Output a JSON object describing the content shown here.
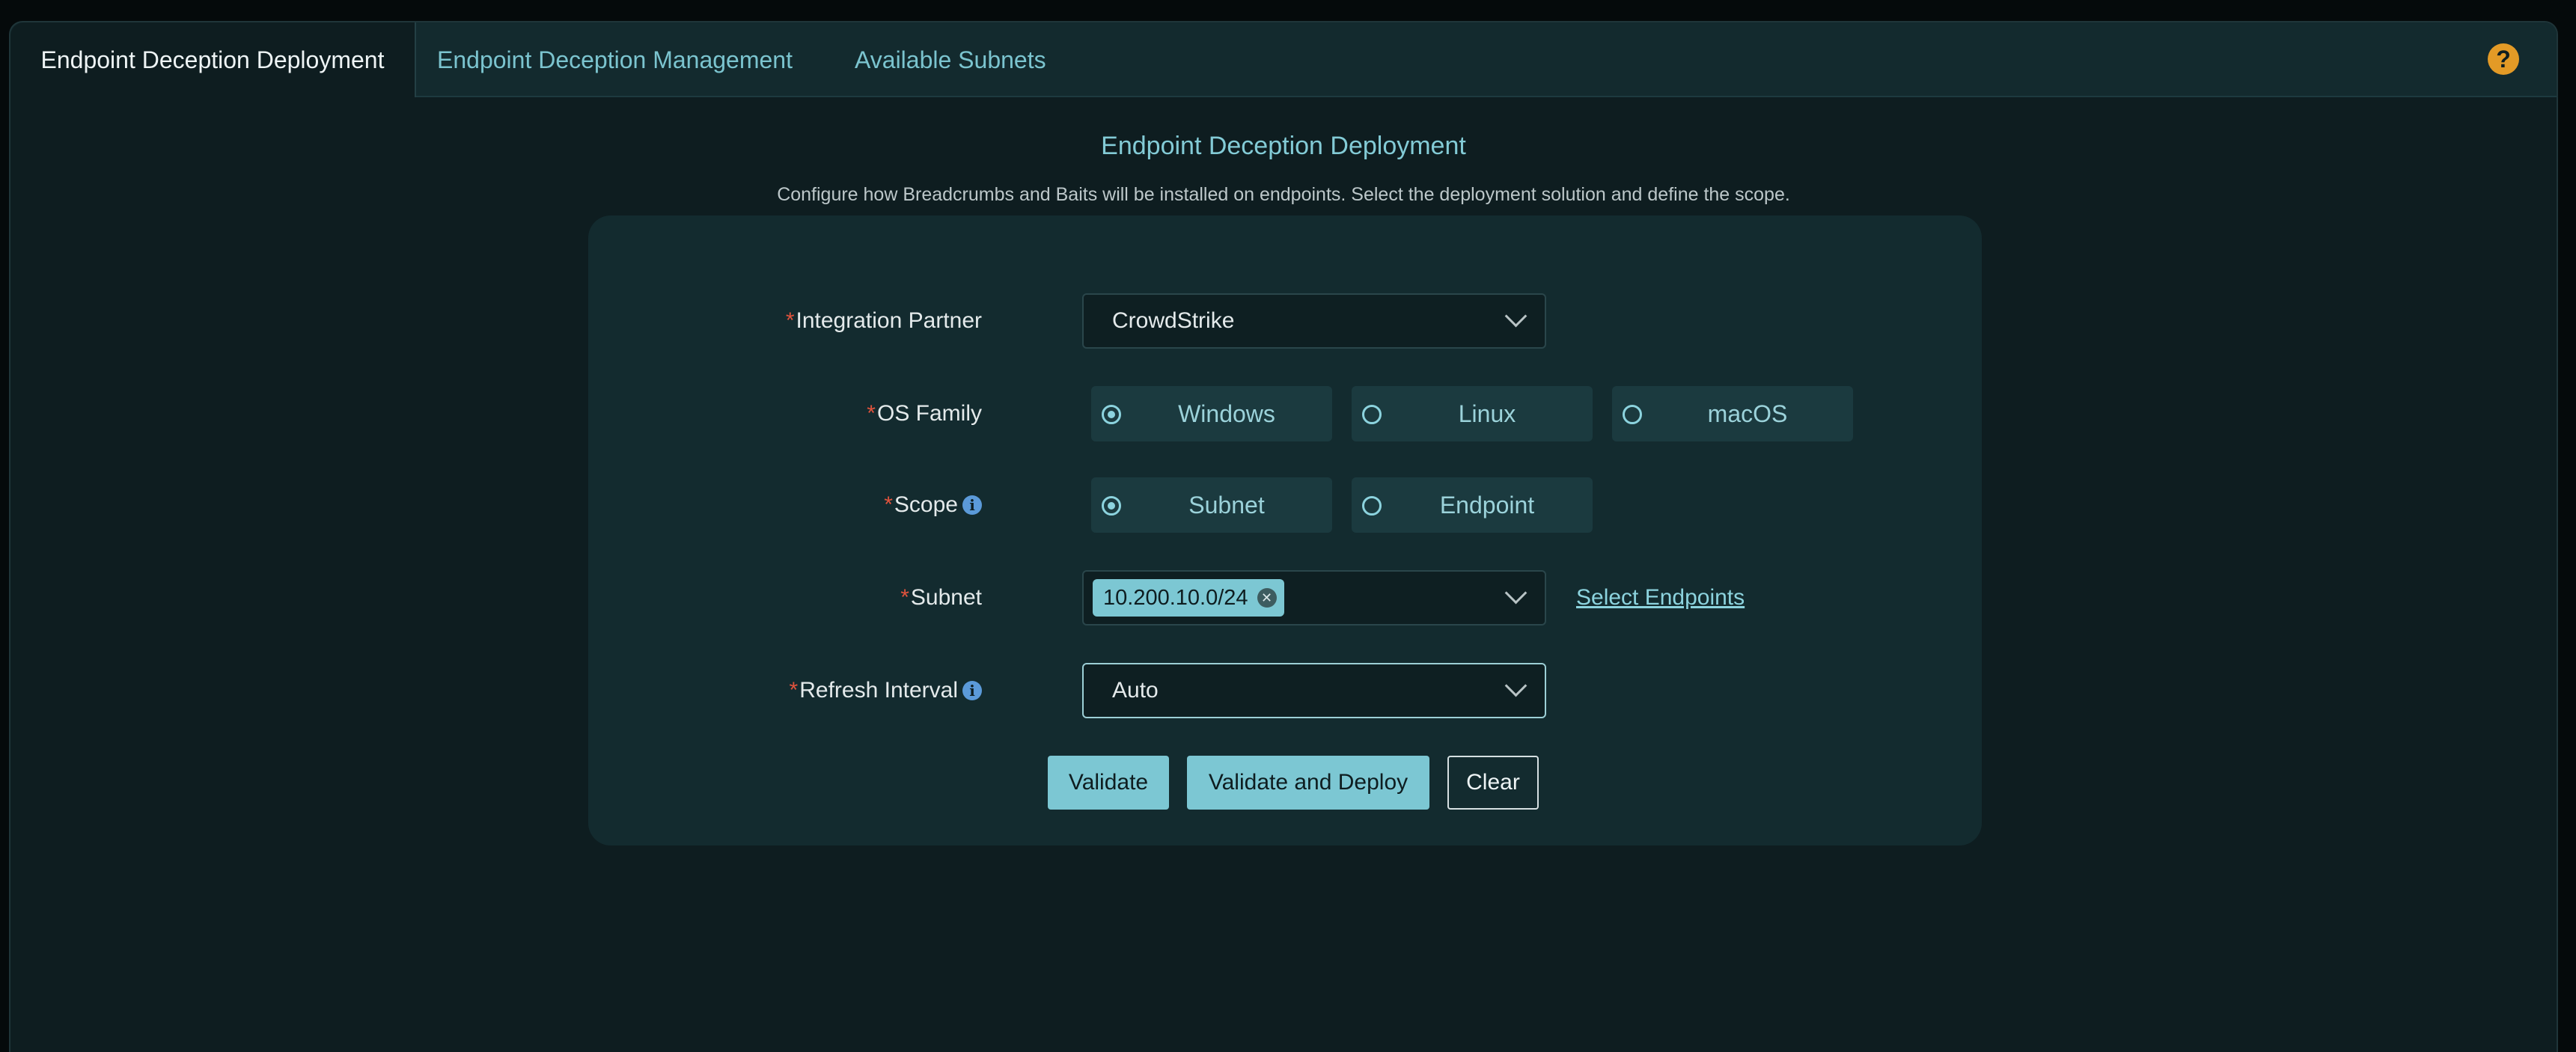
{
  "tabs": [
    {
      "label": "Endpoint Deception Deployment",
      "active": true
    },
    {
      "label": "Endpoint Deception Management",
      "active": false
    },
    {
      "label": "Available Subnets",
      "active": false
    }
  ],
  "help_icon": "question-circle-icon",
  "page": {
    "title": "Endpoint Deception Deployment",
    "subtitle": "Configure how Breadcrumbs and Baits will be installed on endpoints. Select the deployment solution and define the scope."
  },
  "form": {
    "required_marker": "*",
    "integration_partner": {
      "label": "Integration Partner",
      "value": "CrowdStrike"
    },
    "os_family": {
      "label": "OS Family",
      "options": [
        "Windows",
        "Linux",
        "macOS"
      ],
      "selected": "Windows"
    },
    "scope": {
      "label": "Scope",
      "options": [
        "Subnet",
        "Endpoint"
      ],
      "selected": "Subnet"
    },
    "subnet": {
      "label": "Subnet",
      "chips": [
        "10.200.10.0/24"
      ],
      "link": "Select Endpoints"
    },
    "refresh_interval": {
      "label": "Refresh Interval",
      "value": "Auto"
    }
  },
  "buttons": {
    "validate": "Validate",
    "validate_deploy": "Validate and Deploy",
    "clear": "Clear"
  },
  "colors": {
    "accent": "#7cc7d3",
    "required": "#e0533d",
    "help": "#e39a26",
    "background": "#0e1d20"
  }
}
